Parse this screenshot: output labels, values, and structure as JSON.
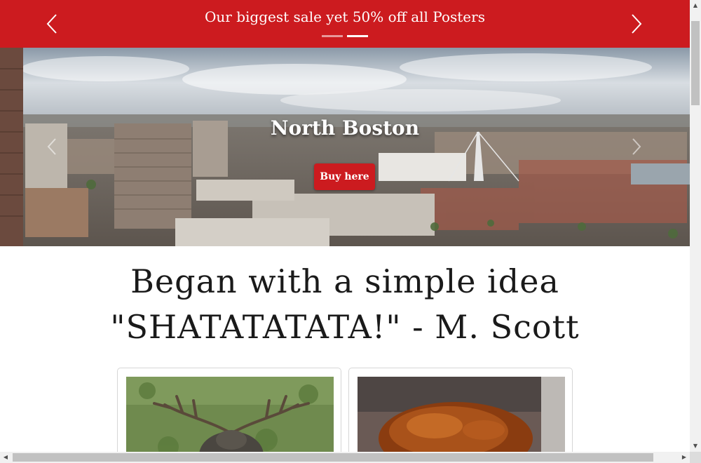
{
  "promo": {
    "message": "Our biggest sale yet 50% off all Posters",
    "slides": 2,
    "active_slide": 2,
    "color": "#cc1b1f"
  },
  "hero": {
    "title": "North Boston",
    "button_label": "Buy here"
  },
  "headline": {
    "line1": "Began with a simple idea",
    "line2": "\"SHATATATATA!\" - M. Scott"
  },
  "cards": [
    {
      "image": "moose-photo"
    },
    {
      "image": "roast-turkey-photo"
    }
  ],
  "icons": {
    "prev": "chevron-left-icon",
    "next": "chevron-right-icon"
  }
}
